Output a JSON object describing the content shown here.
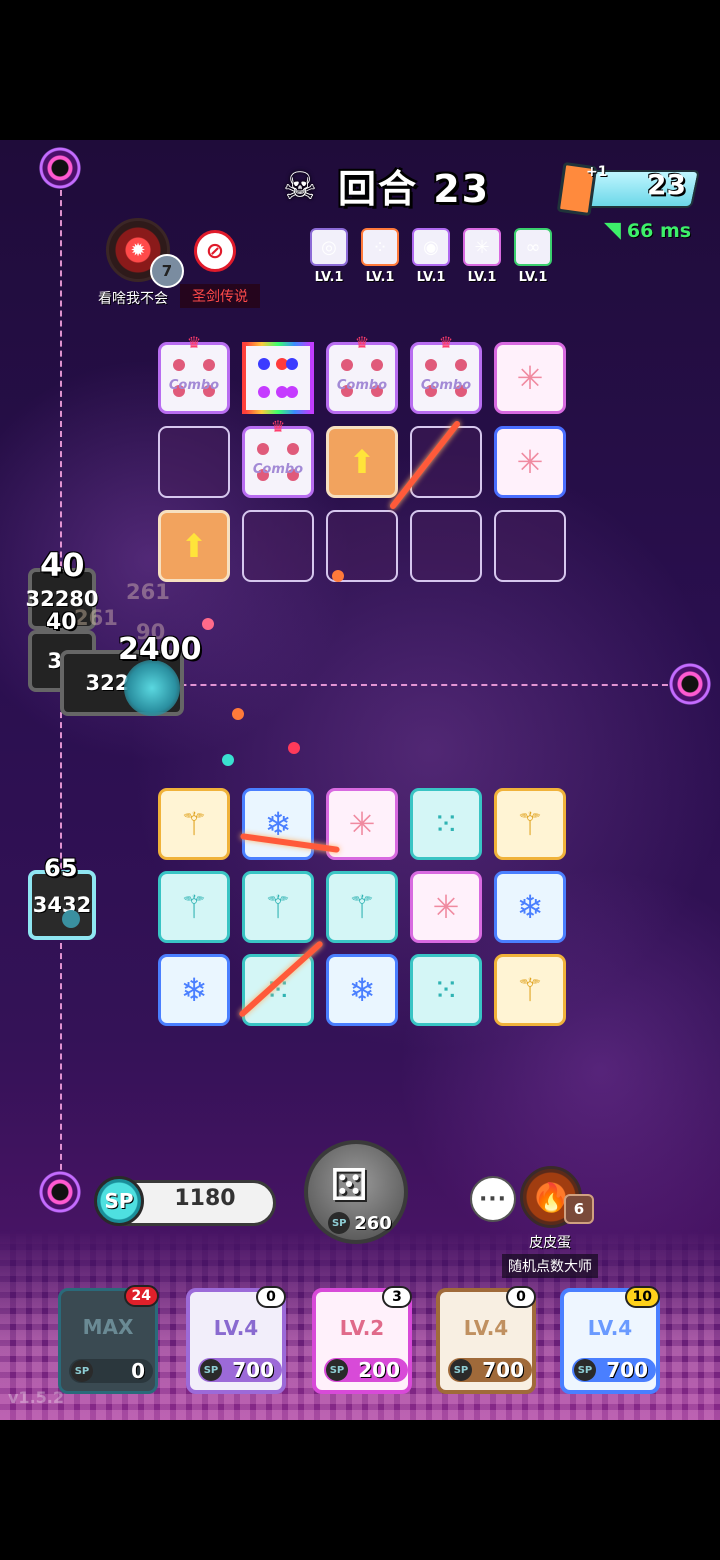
{
  "hud": {
    "round_label": "回合 23",
    "boss_icon": "demon-skull-icon",
    "card_counter": {
      "plus": "+1",
      "value": "23"
    },
    "ping": {
      "value": "66 ms",
      "icon": "wifi-icon"
    }
  },
  "opponent": {
    "name": "看啥我不会",
    "title": "圣剑传说",
    "rank": "7",
    "block_icon": "block-icon",
    "dice_levels": [
      {
        "label": "LV.1",
        "icon": "combo-dice"
      },
      {
        "label": "LV.1",
        "icon": "rainbow-dice"
      },
      {
        "label": "LV.1",
        "icon": "combo-dice"
      },
      {
        "label": "LV.1",
        "icon": "star-dice"
      },
      {
        "label": "LV.1",
        "icon": "infinity-dice"
      }
    ],
    "board": [
      {
        "type": "combo",
        "text": "Combo"
      },
      {
        "type": "rainbow",
        "text": ""
      },
      {
        "type": "combo",
        "text": "Combo"
      },
      {
        "type": "combo",
        "text": "Combo"
      },
      {
        "type": "star",
        "text": ""
      },
      {
        "type": "empty",
        "text": ""
      },
      {
        "type": "combo",
        "text": "Combo"
      },
      {
        "type": "arrow",
        "text": ""
      },
      {
        "type": "empty",
        "text": ""
      },
      {
        "type": "star",
        "text": ""
      },
      {
        "type": "arrow",
        "text": ""
      },
      {
        "type": "empty",
        "text": ""
      },
      {
        "type": "empty",
        "text": ""
      },
      {
        "type": "empty",
        "text": ""
      },
      {
        "type": "empty",
        "text": ""
      }
    ]
  },
  "enemies": {
    "top_cluster": [
      {
        "hp": "32280"
      },
      {
        "hp": "32"
      },
      {
        "hp": "32212"
      }
    ],
    "left_enemy_hp": "3432",
    "floating_numbers": [
      "40",
      "40",
      "2400",
      "65"
    ],
    "faint_numbers": [
      "261",
      "261",
      "90"
    ]
  },
  "player": {
    "name": "皮皮蛋",
    "title": "随机点数大师",
    "rank": "6",
    "sp": "1180",
    "roll_cost": "260",
    "board": [
      {
        "type": "gold"
      },
      {
        "type": "ice"
      },
      {
        "type": "star"
      },
      {
        "type": "teal"
      },
      {
        "type": "gold"
      },
      {
        "type": "teal"
      },
      {
        "type": "teal"
      },
      {
        "type": "teal"
      },
      {
        "type": "star"
      },
      {
        "type": "ice"
      },
      {
        "type": "ice"
      },
      {
        "type": "teal"
      },
      {
        "type": "ice"
      },
      {
        "type": "teal"
      },
      {
        "type": "gold"
      }
    ],
    "deck": [
      {
        "label": "MAX",
        "badge": "24",
        "cost": "0",
        "style": "teal"
      },
      {
        "label": "LV.4",
        "badge": "0",
        "cost": "700",
        "style": "purple"
      },
      {
        "label": "LV.2",
        "badge": "3",
        "cost": "200",
        "style": "pink"
      },
      {
        "label": "LV.4",
        "badge": "0",
        "cost": "700",
        "style": "brown"
      },
      {
        "label": "LV.4",
        "badge": "10",
        "cost": "700",
        "style": "ice"
      }
    ]
  },
  "version": "v1.5.2",
  "colors": {
    "accent_cyan": "#4ee0e0",
    "ping_green": "#3df06a",
    "opponent_title_red": "#ff4a4a",
    "badge_red": "#e0202a",
    "badge_yellow": "#ffd21a"
  }
}
